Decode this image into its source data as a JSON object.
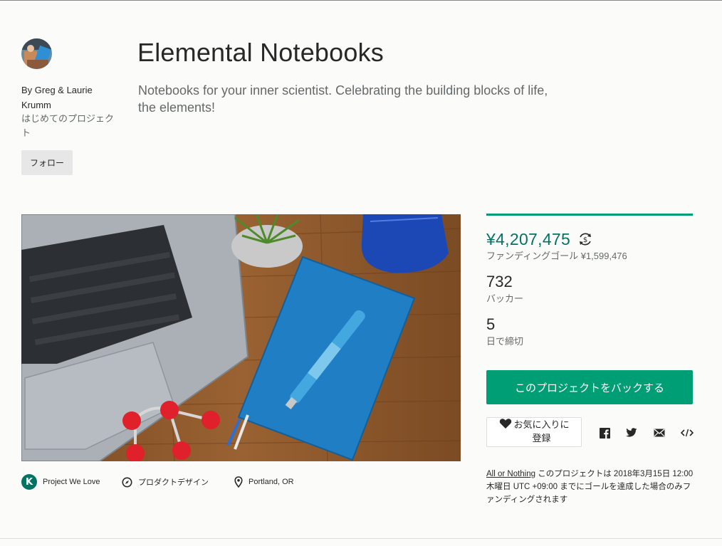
{
  "project": {
    "title": "Elemental Notebooks",
    "blurb": "Notebooks for your inner scientist. Celebrating the building blocks of life, the elements!"
  },
  "creator": {
    "by_line": "By Greg & Laurie Krumm",
    "first_project": "はじめてのプロジェクト",
    "follow_label": "フォロー",
    "avatar_icon": "avatar-photo"
  },
  "meta": {
    "badge_letter": "K",
    "project_we_love": "Project We Love",
    "category": "プロダクトデザイン",
    "location": "Portland, OR",
    "category_icon": "compass-icon",
    "location_icon": "location-pin-icon"
  },
  "stats": {
    "pledged": "¥4,207,475",
    "goal": "ファンディングゴール ¥1,599,476",
    "backers_count": "732",
    "backers_label": "バッカー",
    "days_count": "5",
    "days_label": "日で締切"
  },
  "actions": {
    "back_label": "このプロジェクトをバックする",
    "remind_label": "お気に入りに登録"
  },
  "share": [
    "facebook-icon",
    "twitter-icon",
    "email-icon",
    "embed-icon"
  ],
  "terms": {
    "link": "All or Nothing",
    "text": " このプロジェクトは 2018年3月15日 12:00 木曜日 UTC +09:00 までにゴールを達成した場合のみファンディングされます"
  },
  "colors": {
    "accent": "#009e74",
    "accent_dark": "#037362",
    "muted_text": "#656969",
    "background": "#fbfbfa"
  }
}
